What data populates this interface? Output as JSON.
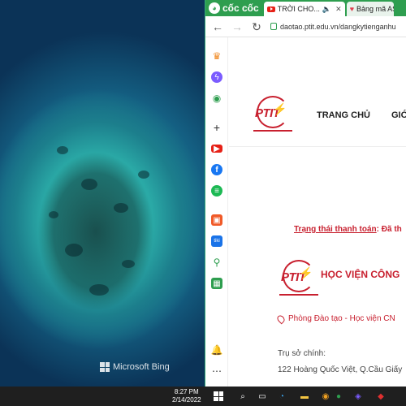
{
  "desktop": {
    "wallpaper_credit": "Microsoft Bing"
  },
  "browser": {
    "brand": "cốc cốc",
    "tabs": [
      {
        "title": "TRỜI CHO..."
      },
      {
        "title": "Bảng mã AS"
      }
    ],
    "address": "daotao.ptit.edu.vn/dangkytienganhu"
  },
  "site": {
    "logo_text": "PTIT",
    "menu": [
      "TRANG CHỦ",
      "GIỚ"
    ],
    "payment_status_key": "Trạng thái thanh toán",
    "payment_status_value": ": Đã th",
    "institution_name": "HỌC VIỆN CÔNG",
    "office_line": "Phòng Đào tạo - Học viện CN",
    "hq_label": "Trụ sở chính:",
    "hq_address": "122 Hoàng Quốc Việt, Q.Cầu Giấy"
  },
  "taskbar": {
    "time": "8:27 PM",
    "date": "2/14/2022"
  }
}
